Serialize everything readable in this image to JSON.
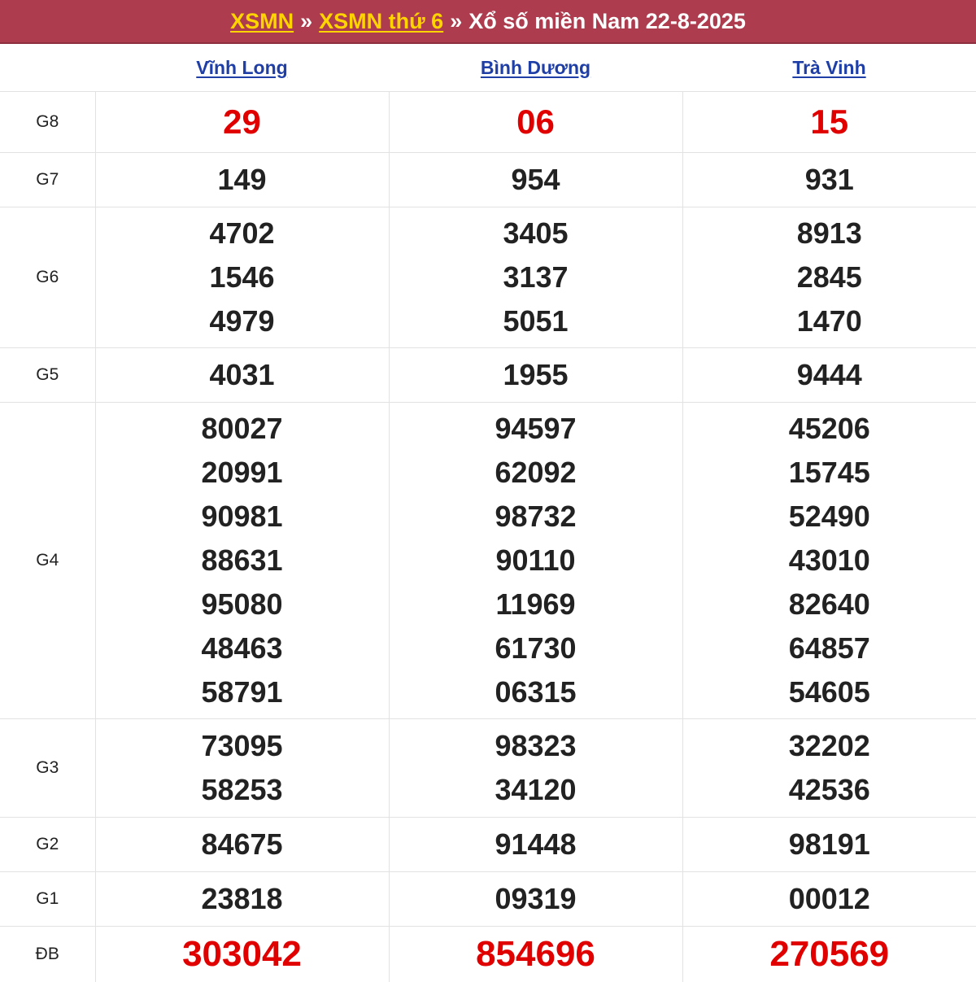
{
  "header": {
    "link1": "XSMN",
    "sep1": "»",
    "link2": "XSMN thứ 6",
    "sep2": "»",
    "title": "Xổ số miền Nam 22-8-2025"
  },
  "provinces": [
    "Vĩnh Long",
    "Bình Dương",
    "Trà Vinh"
  ],
  "prizes": [
    {
      "label": "G8",
      "values": [
        [
          "29"
        ],
        [
          "06"
        ],
        [
          "15"
        ]
      ]
    },
    {
      "label": "G7",
      "values": [
        [
          "149"
        ],
        [
          "954"
        ],
        [
          "931"
        ]
      ]
    },
    {
      "label": "G6",
      "values": [
        [
          "4702",
          "1546",
          "4979"
        ],
        [
          "3405",
          "3137",
          "5051"
        ],
        [
          "8913",
          "2845",
          "1470"
        ]
      ]
    },
    {
      "label": "G5",
      "values": [
        [
          "4031"
        ],
        [
          "1955"
        ],
        [
          "9444"
        ]
      ]
    },
    {
      "label": "G4",
      "values": [
        [
          "80027",
          "20991",
          "90981",
          "88631",
          "95080",
          "48463",
          "58791"
        ],
        [
          "94597",
          "62092",
          "98732",
          "90110",
          "11969",
          "61730",
          "06315"
        ],
        [
          "45206",
          "15745",
          "52490",
          "43010",
          "82640",
          "64857",
          "54605"
        ]
      ]
    },
    {
      "label": "G3",
      "values": [
        [
          "73095",
          "58253"
        ],
        [
          "98323",
          "34120"
        ],
        [
          "32202",
          "42536"
        ]
      ]
    },
    {
      "label": "G2",
      "values": [
        [
          "84675"
        ],
        [
          "91448"
        ],
        [
          "98191"
        ]
      ]
    },
    {
      "label": "G1",
      "values": [
        [
          "23818"
        ],
        [
          "09319"
        ],
        [
          "00012"
        ]
      ]
    },
    {
      "label": "ĐB",
      "values": [
        [
          "303042"
        ],
        [
          "854696"
        ],
        [
          "270569"
        ]
      ]
    }
  ],
  "colors": {
    "header_bg": "#ad3c4e",
    "header_link": "#ffd400",
    "province_link": "#1f3fa6",
    "highlight": "#e00000"
  }
}
